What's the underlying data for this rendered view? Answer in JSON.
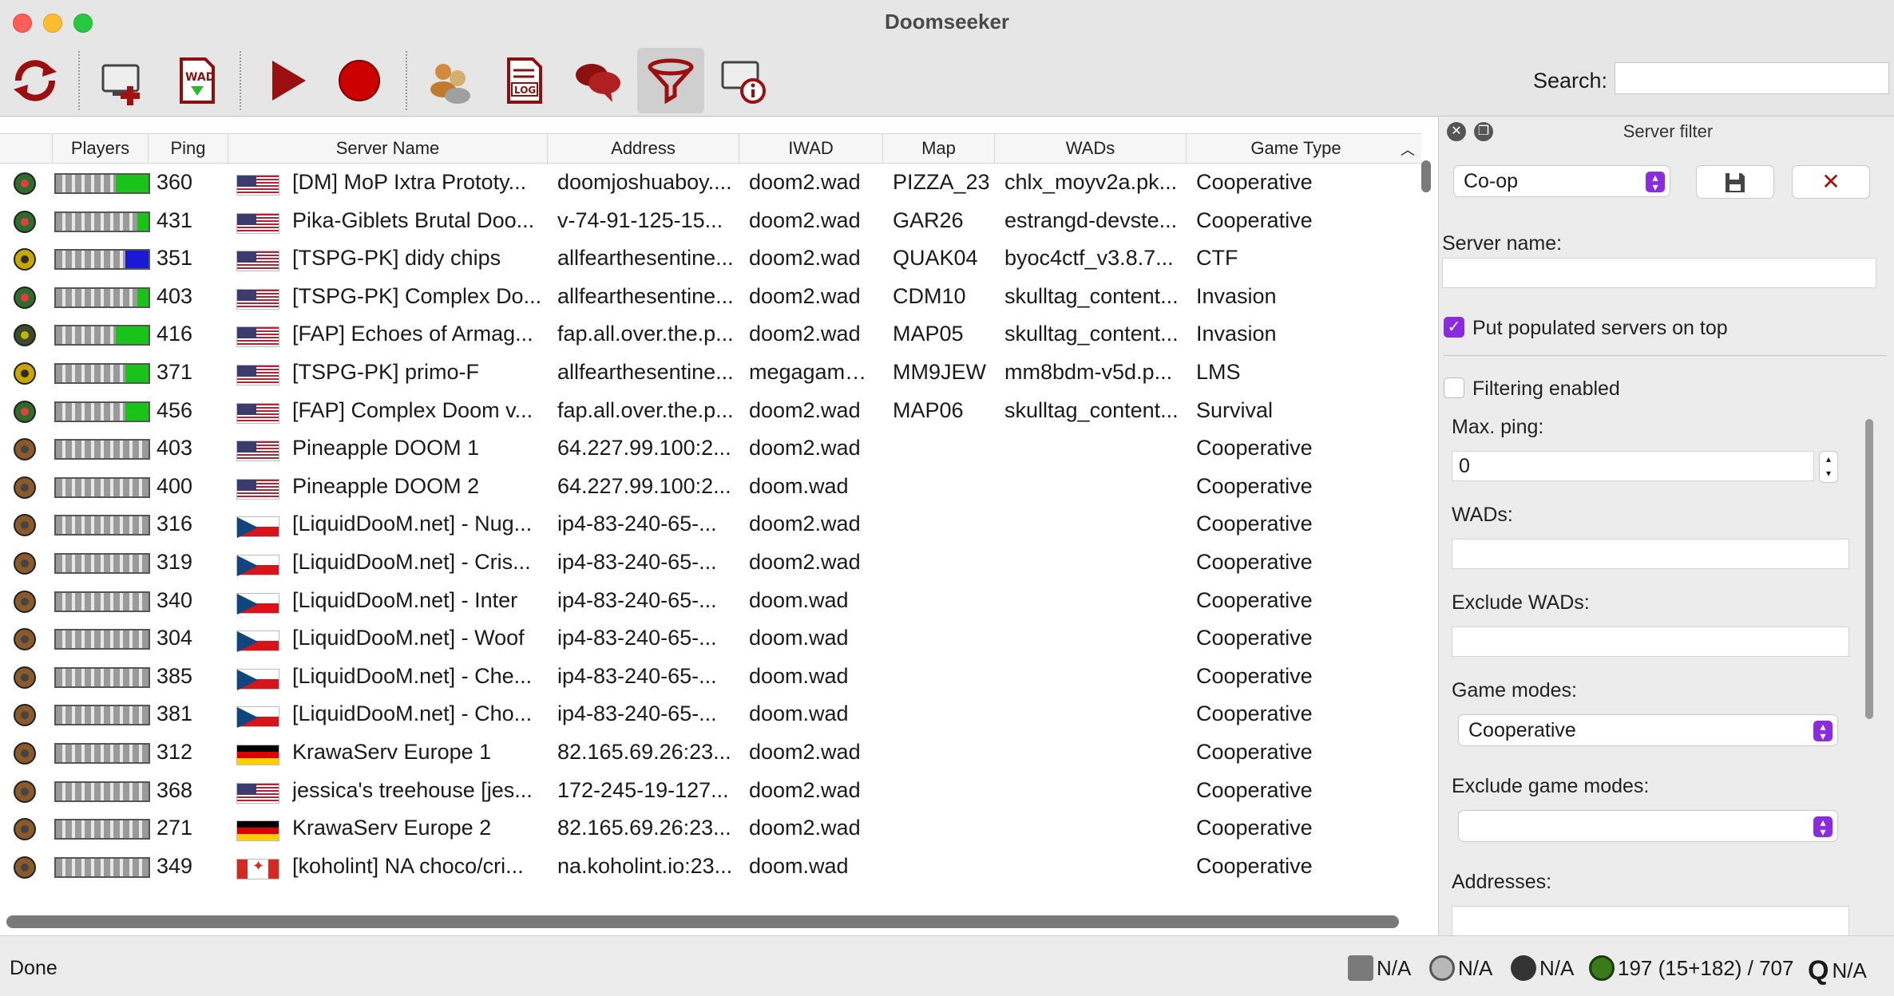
{
  "window": {
    "title": "Doomseeker"
  },
  "toolbar": {
    "buttons": [
      {
        "icon": "refresh-icon"
      },
      {
        "icon": "create-server-icon"
      },
      {
        "icon": "wad-download-icon"
      },
      {
        "icon": "play-icon"
      },
      {
        "icon": "record-icon"
      },
      {
        "icon": "buddies-icon"
      },
      {
        "icon": "log-icon"
      },
      {
        "icon": "irc-chat-icon"
      },
      {
        "icon": "filter-icon"
      },
      {
        "icon": "server-info-icon"
      }
    ],
    "search_label": "Search:",
    "search_value": ""
  },
  "server_list": {
    "columns": [
      "Players",
      "Ping",
      "Server Name",
      "Address",
      "IWAD",
      "Map",
      "WADs",
      "Game Type"
    ],
    "rows": [
      {
        "status": "secure",
        "players_fill": 0.35,
        "players_color": "#19c319",
        "ping": "360",
        "flag": "us",
        "name": "[DM] MoP Ixtra Prototy...",
        "address": "doomjoshuaboy....",
        "iwad": "doom2.wad",
        "map": "PIZZA_23",
        "wads": "chlx_moyv2a.pk...",
        "gametype": "Cooperative"
      },
      {
        "status": "secure",
        "players_fill": 0.12,
        "players_color": "#19c319",
        "ping": "431",
        "flag": "us",
        "name": "Pika-Giblets Brutal Doo...",
        "address": "v-74-91-125-15...",
        "iwad": "doom2.wad",
        "map": "GAR26",
        "wads": "estrangd-devste...",
        "gametype": "Cooperative"
      },
      {
        "status": "locked",
        "players_fill": 0.25,
        "players_color": "#1a1ad6",
        "ping": "351",
        "flag": "us",
        "name": "[TSPG-PK] didy chips",
        "address": "allfearthesentine...",
        "iwad": "doom2.wad",
        "map": "QUAK04",
        "wads": "byoc4ctf_v3.8.7...",
        "gametype": "CTF"
      },
      {
        "status": "secure",
        "players_fill": 0.12,
        "players_color": "#19c319",
        "ping": "403",
        "flag": "us",
        "name": "[TSPG-PK] Complex Do...",
        "address": "allfearthesentine...",
        "iwad": "doom2.wad",
        "map": "CDM10",
        "wads": "skulltag_content...",
        "gametype": "Invasion"
      },
      {
        "status": "secure-dark",
        "players_fill": 0.35,
        "players_color": "#19c319",
        "ping": "416",
        "flag": "us",
        "name": "[FAP] Echoes of Armag...",
        "address": "fap.all.over.the.p...",
        "iwad": "doom2.wad",
        "map": "MAP05",
        "wads": "skulltag_content...",
        "gametype": "Invasion"
      },
      {
        "status": "locked",
        "players_fill": 0.25,
        "players_color": "#19c319",
        "ping": "371",
        "flag": "us",
        "name": "[TSPG-PK] primo-F",
        "address": "allfearthesentine...",
        "iwad": "megagame....",
        "map": "MM9JEW",
        "wads": "mm8bdm-v5d.p...",
        "gametype": "LMS"
      },
      {
        "status": "secure",
        "players_fill": 0.25,
        "players_color": "#19c319",
        "ping": "456",
        "flag": "us",
        "name": "[FAP] Complex Doom v...",
        "address": "fap.all.over.the.p...",
        "iwad": "doom2.wad",
        "map": "MAP06",
        "wads": "skulltag_content...",
        "gametype": "Survival"
      },
      {
        "status": "empty",
        "players_fill": 0,
        "players_color": "#19c319",
        "ping": "403",
        "flag": "us",
        "name": "Pineapple DOOM 1",
        "address": "64.227.99.100:2...",
        "iwad": "doom2.wad",
        "map": "",
        "wads": "",
        "gametype": "Cooperative"
      },
      {
        "status": "empty",
        "players_fill": 0,
        "players_color": "#19c319",
        "ping": "400",
        "flag": "us",
        "name": "Pineapple DOOM 2",
        "address": "64.227.99.100:2...",
        "iwad": "doom.wad",
        "map": "",
        "wads": "",
        "gametype": "Cooperative"
      },
      {
        "status": "empty",
        "players_fill": 0,
        "players_color": "#19c319",
        "ping": "316",
        "flag": "cz",
        "name": "[LiquidDooM.net] - Nug...",
        "address": "ip4-83-240-65-...",
        "iwad": "doom2.wad",
        "map": "",
        "wads": "",
        "gametype": "Cooperative"
      },
      {
        "status": "empty",
        "players_fill": 0,
        "players_color": "#19c319",
        "ping": "319",
        "flag": "cz",
        "name": "[LiquidDooM.net] - Cris...",
        "address": "ip4-83-240-65-...",
        "iwad": "doom2.wad",
        "map": "",
        "wads": "",
        "gametype": "Cooperative"
      },
      {
        "status": "empty",
        "players_fill": 0,
        "players_color": "#19c319",
        "ping": "340",
        "flag": "cz",
        "name": "[LiquidDooM.net] - Inter",
        "address": "ip4-83-240-65-...",
        "iwad": "doom.wad",
        "map": "",
        "wads": "",
        "gametype": "Cooperative"
      },
      {
        "status": "empty",
        "players_fill": 0,
        "players_color": "#19c319",
        "ping": "304",
        "flag": "cz",
        "name": "[LiquidDooM.net] - Woof",
        "address": "ip4-83-240-65-...",
        "iwad": "doom.wad",
        "map": "",
        "wads": "",
        "gametype": "Cooperative"
      },
      {
        "status": "empty",
        "players_fill": 0,
        "players_color": "#19c319",
        "ping": "385",
        "flag": "cz",
        "name": "[LiquidDooM.net] - Che...",
        "address": "ip4-83-240-65-...",
        "iwad": "doom.wad",
        "map": "",
        "wads": "",
        "gametype": "Cooperative"
      },
      {
        "status": "empty",
        "players_fill": 0,
        "players_color": "#19c319",
        "ping": "381",
        "flag": "cz",
        "name": "[LiquidDooM.net] - Cho...",
        "address": "ip4-83-240-65-...",
        "iwad": "doom.wad",
        "map": "",
        "wads": "",
        "gametype": "Cooperative"
      },
      {
        "status": "empty",
        "players_fill": 0,
        "players_color": "#19c319",
        "ping": "312",
        "flag": "de",
        "name": "KrawaServ Europe 1",
        "address": "82.165.69.26:23...",
        "iwad": "doom2.wad",
        "map": "",
        "wads": "",
        "gametype": "Cooperative"
      },
      {
        "status": "empty",
        "players_fill": 0,
        "players_color": "#19c319",
        "ping": "368",
        "flag": "us",
        "name": "jessica's treehouse [jes...",
        "address": "172-245-19-127...",
        "iwad": "doom2.wad",
        "map": "",
        "wads": "",
        "gametype": "Cooperative"
      },
      {
        "status": "empty",
        "players_fill": 0,
        "players_color": "#19c319",
        "ping": "271",
        "flag": "de",
        "name": "KrawaServ Europe 2",
        "address": "82.165.69.26:23...",
        "iwad": "doom2.wad",
        "map": "",
        "wads": "",
        "gametype": "Cooperative"
      },
      {
        "status": "empty",
        "players_fill": 0,
        "players_color": "#19c319",
        "ping": "349",
        "flag": "ca",
        "name": "[koholint] NA choco/cri...",
        "address": "na.koholint.io:23...",
        "iwad": "doom.wad",
        "map": "",
        "wads": "",
        "gametype": "Cooperative"
      }
    ]
  },
  "filter_panel": {
    "title": "Server filter",
    "preset": "Co-op",
    "save_icon": "save-icon",
    "clear_icon": "clear-icon",
    "server_name_label": "Server name:",
    "server_name_value": "",
    "populated_on_top_label": "Put populated servers on top",
    "populated_on_top": true,
    "filtering_enabled_label": "Filtering enabled",
    "filtering_enabled": false,
    "max_ping_label": "Max. ping:",
    "max_ping_value": "0",
    "wads_label": "WADs:",
    "wads_value": "",
    "exclude_wads_label": "Exclude WADs:",
    "exclude_wads_value": "",
    "game_modes_label": "Game modes:",
    "game_modes_value": "Cooperative",
    "exclude_game_modes_label": "Exclude game modes:",
    "exclude_game_modes_value": "",
    "addresses_label": "Addresses:"
  },
  "statusbar": {
    "status": "Done",
    "items": [
      {
        "icon": "doom-engine-icon",
        "text": "N/A"
      },
      {
        "icon": "helmet-engine-icon",
        "text": "N/A"
      },
      {
        "icon": "odamex-icon",
        "text": "N/A"
      },
      {
        "icon": "zandronum-icon",
        "text": "197 (15+182) / 707"
      },
      {
        "icon": "q-engine-icon",
        "text": "N/A"
      }
    ]
  }
}
